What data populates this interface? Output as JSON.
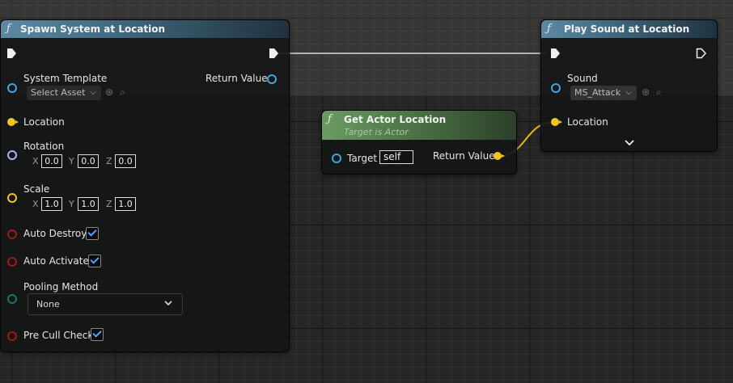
{
  "colors": {
    "obj_pin": "#3ea7e0",
    "vector_pin": "#f5c51c",
    "rotator_pin": "#a0b4ff",
    "bool_pin": "#9b1a1a",
    "enum_pin": "#0e7a6d",
    "wire_exec": "#e0e0e0",
    "wire_vector": "#e8b91a"
  },
  "spawn_node": {
    "icon": "function-icon",
    "title": "Spawn System at Location",
    "system_template_label": "System Template",
    "system_template_value": "Select Asset",
    "return_value_label": "Return Value",
    "location_label": "Location",
    "rotation_label": "Rotation",
    "rotation": {
      "x_label": "X",
      "x": "0.0",
      "y_label": "Y",
      "y": "0.0",
      "z_label": "Z",
      "z": "0.0"
    },
    "scale_label": "Scale",
    "scale": {
      "x_label": "X",
      "x": "1.0",
      "y_label": "Y",
      "y": "1.0",
      "z_label": "Z",
      "z": "1.0"
    },
    "auto_destroy_label": "Auto Destroy",
    "auto_destroy": true,
    "auto_activate_label": "Auto Activate",
    "auto_activate": true,
    "pooling_method_label": "Pooling Method",
    "pooling_method_value": "None",
    "pre_cull_check_label": "Pre Cull Check",
    "pre_cull_check": true
  },
  "get_actor_location_node": {
    "icon": "function-icon",
    "title": "Get Actor Location",
    "subtitle": "Target is Actor",
    "target_label": "Target",
    "target_value": "self",
    "return_value_label": "Return Value"
  },
  "play_sound_node": {
    "icon": "function-icon",
    "title": "Play Sound at Location",
    "sound_label": "Sound",
    "sound_value": "MS_Attack",
    "location_label": "Location"
  }
}
